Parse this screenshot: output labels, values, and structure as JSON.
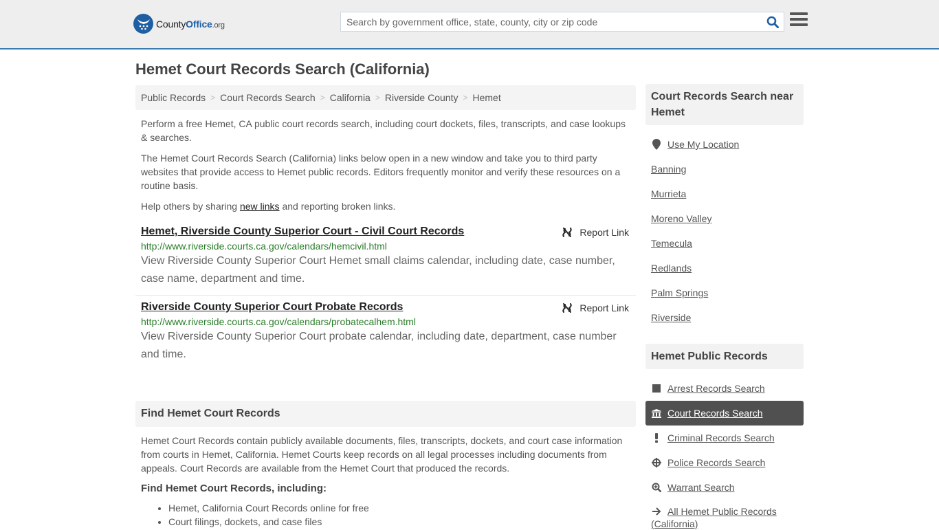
{
  "header": {
    "logo": {
      "name_part1": "County",
      "name_part2": "Office",
      "tld": ".org"
    },
    "search": {
      "placeholder": "Search by government office, state, county, city or zip code",
      "value": ""
    },
    "colors": {
      "brand": "#1e5fa4",
      "accent_border": "#3a7bb0"
    }
  },
  "page": {
    "title": "Hemet Court Records Search (California)",
    "breadcrumb": [
      {
        "label": "Public Records"
      },
      {
        "label": "Court Records Search"
      },
      {
        "label": "California"
      },
      {
        "label": "Riverside County"
      },
      {
        "label": "Hemet"
      }
    ],
    "breadcrumb_separator": ">",
    "intro": {
      "p1": "Perform a free Hemet, CA public court records search, including court dockets, files, transcripts, and case lookups & searches.",
      "p2": "The Hemet Court Records Search (California) links below open in a new window and take you to third party websites that provide access to Hemet public records. Editors frequently monitor and verify these resources on a routine basis.",
      "p3_before": "Help others by sharing ",
      "p3_link": "new links",
      "p3_after": " and reporting broken links."
    },
    "results": [
      {
        "title": "Hemet, Riverside County Superior Court - Civil Court Records",
        "url": "http://www.riverside.courts.ca.gov/calendars/hemcivil.html",
        "description": "View Riverside County Superior Court Hemet small claims calendar, including date, case number, case name, department and time.",
        "report_label": "Report Link"
      },
      {
        "title": "Riverside County Superior Court Probate Records",
        "url": "http://www.riverside.courts.ca.gov/calendars/probatecalhem.html",
        "description": "View Riverside County Superior Court probate calendar, including date, department, case number and time.",
        "report_label": "Report Link"
      }
    ],
    "find_section": {
      "heading": "Find Hemet Court Records",
      "body": "Hemet Court Records contain publicly available documents, files, transcripts, dockets, and court case information from courts in Hemet, California. Hemet Courts keep records on all legal processes including documents from appeals. Court Records are available from the Hemet Court that produced the records.",
      "subheading": "Find Hemet Court Records, including:",
      "items": [
        "Hemet, California Court Records online for free",
        "Court filings, dockets, and case files"
      ]
    }
  },
  "sidebar": {
    "nearby": {
      "heading": "Court Records Search near Hemet",
      "use_location": "Use My Location",
      "cities": [
        "Banning",
        "Murrieta",
        "Moreno Valley",
        "Temecula",
        "Redlands",
        "Palm Springs",
        "Riverside"
      ]
    },
    "public_records": {
      "heading": "Hemet Public Records",
      "items": [
        {
          "label": "Arrest Records Search",
          "icon": "square-icon",
          "active": false
        },
        {
          "label": "Court Records Search",
          "icon": "courthouse-icon",
          "active": true
        },
        {
          "label": "Criminal Records Search",
          "icon": "exclamation-icon",
          "active": false
        },
        {
          "label": "Police Records Search",
          "icon": "crosshairs-icon",
          "active": false
        },
        {
          "label": "Warrant Search",
          "icon": "zoom-in-icon",
          "active": false
        },
        {
          "label": "All Hemet Public Records",
          "suffix": "(California)",
          "icon": "arrow-right-icon",
          "active": false
        }
      ],
      "active_color": "#505050"
    }
  }
}
